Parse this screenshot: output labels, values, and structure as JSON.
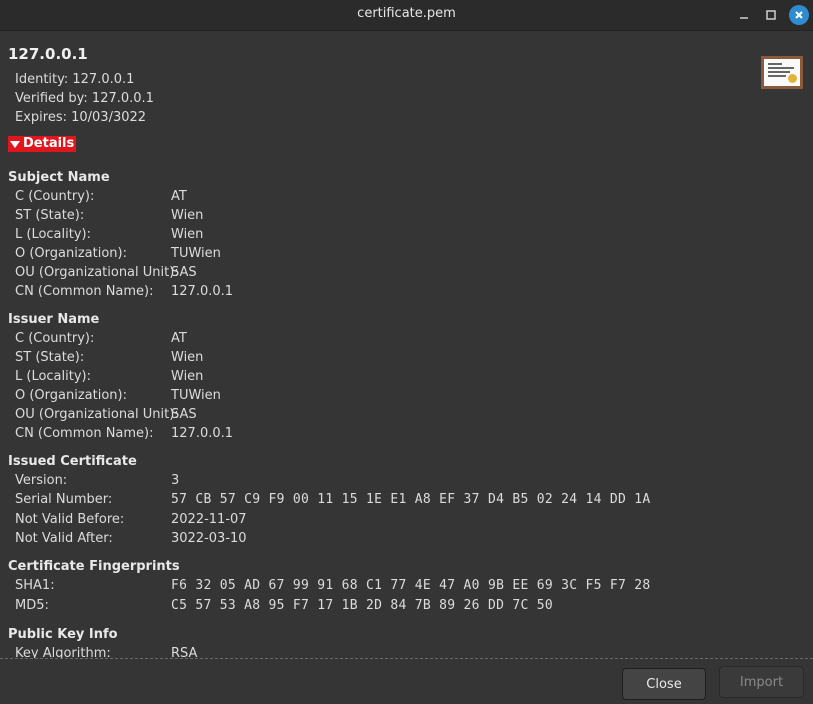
{
  "window": {
    "title": "certificate.pem",
    "minimize_glyph": "—",
    "maximize_glyph": "□",
    "close_glyph": "✕"
  },
  "certificate": {
    "title": "127.0.0.1",
    "identity": "Identity: 127.0.0.1",
    "verified_by": "Verified by: 127.0.0.1",
    "expires": "Expires: 10/03/3022",
    "icon": "certificate-icon"
  },
  "details_toggle": {
    "label": "Details",
    "icon": "triangle-down-icon"
  },
  "sections": {
    "subject": {
      "heading": "Subject Name",
      "rows": [
        {
          "label": "C (Country):",
          "value": "AT"
        },
        {
          "label": "ST (State):",
          "value": "Wien"
        },
        {
          "label": "L (Locality):",
          "value": "Wien"
        },
        {
          "label": "O (Organization):",
          "value": "TUWien"
        },
        {
          "label": "OU (Organizational Unit):",
          "value": "SAS"
        },
        {
          "label": "CN (Common Name):",
          "value": "127.0.0.1"
        }
      ]
    },
    "issuer": {
      "heading": "Issuer Name",
      "rows": [
        {
          "label": "C (Country):",
          "value": "AT"
        },
        {
          "label": "ST (State):",
          "value": "Wien"
        },
        {
          "label": "L (Locality):",
          "value": "Wien"
        },
        {
          "label": "O (Organization):",
          "value": "TUWien"
        },
        {
          "label": "OU (Organizational Unit):",
          "value": "SAS"
        },
        {
          "label": "CN (Common Name):",
          "value": "127.0.0.1"
        }
      ]
    },
    "issued": {
      "heading": "Issued Certificate",
      "rows": [
        {
          "label": "Version:",
          "value": "3"
        },
        {
          "label": "Serial Number:",
          "value": "57 CB 57 C9 F9 00 11 15 1E E1 A8 EF 37 D4 B5 02 24 14 DD 1A"
        },
        {
          "label": "Not Valid Before:",
          "value": "2022-11-07"
        },
        {
          "label": "Not Valid After:",
          "value": "3022-03-10"
        }
      ]
    },
    "fingerprints": {
      "heading": "Certificate Fingerprints",
      "rows": [
        {
          "label": "SHA1:",
          "value": "F6 32 05 AD 67 99 91 68 C1 77 4E 47 A0 9B EE 69 3C F5 F7 28"
        },
        {
          "label": "MD5:",
          "value": "C5 57 53 A8 95 F7 17 1B 2D 84 7B 89 26 DD 7C 50"
        }
      ]
    },
    "public_key": {
      "heading": "Public Key Info",
      "rows": [
        {
          "label": "Key Algorithm:",
          "value": "RSA"
        }
      ]
    }
  },
  "buttons": {
    "close": "Close",
    "import": "Import"
  },
  "colors": {
    "background": "#353535",
    "titlebar": "#2b2b2b",
    "details_accent": "#e0161f",
    "close_accent": "#2f8cd0"
  }
}
